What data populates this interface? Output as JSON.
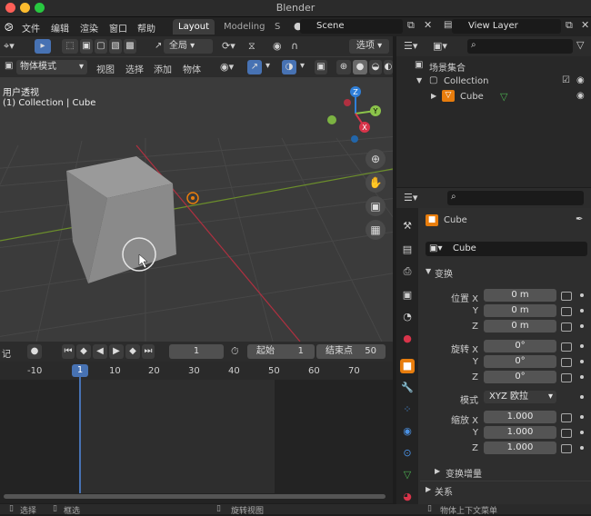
{
  "window": {
    "title": "Blender"
  },
  "menubar": {
    "items": [
      "文件",
      "编辑",
      "渲染",
      "窗口",
      "帮助"
    ],
    "workspaces": [
      "Layout",
      "Modeling",
      "S"
    ],
    "scene": "Scene",
    "view_layer": "View Layer"
  },
  "viewport": {
    "header": {
      "pivot": "全局",
      "options": "选项",
      "mode": "物体模式",
      "menus": [
        "视图",
        "选择",
        "添加",
        "物体"
      ]
    },
    "overlay": {
      "line1": "用户透视",
      "line2": "(1) Collection | Cube"
    },
    "gizmo": {
      "z": "Z",
      "y": "Y",
      "x": "X"
    }
  },
  "timeline": {
    "label": "记",
    "current_frame": "1",
    "start_label": "起始",
    "start": "1",
    "end_label": "结束点",
    "end": "50",
    "ruler": [
      "-10",
      "1",
      "10",
      "20",
      "30",
      "40",
      "50",
      "60",
      "70"
    ]
  },
  "outliner": {
    "root": "场景集合",
    "collection": "Collection",
    "object": "Cube"
  },
  "properties": {
    "object_name": "Cube",
    "data_name": "Cube",
    "transform_header": "变换",
    "location_label": "位置 X",
    "rotation_label": "旋转 X",
    "mode_label": "模式",
    "mode_value": "XYZ 欧拉",
    "scale_label": "缩放 X",
    "y_label": "Y",
    "z_label": "Z",
    "location": [
      "0 m",
      "0 m",
      "0 m"
    ],
    "rotation": [
      "0°",
      "0°",
      "0°"
    ],
    "scale": [
      "1.000",
      "1.000",
      "1.000"
    ],
    "delta_header": "变换增量",
    "relations_header": "关系"
  },
  "statusbar": {
    "select": "选择",
    "box_select": "框选",
    "rotate_view": "旋转视图",
    "context_menu": "物体上下文菜单"
  },
  "colors": {
    "accent": "#4772b3",
    "object_orange": "#e87d0d",
    "x_axis": "#d8344a",
    "y_axis": "#8bc34a",
    "z_axis": "#2f7fd9"
  }
}
